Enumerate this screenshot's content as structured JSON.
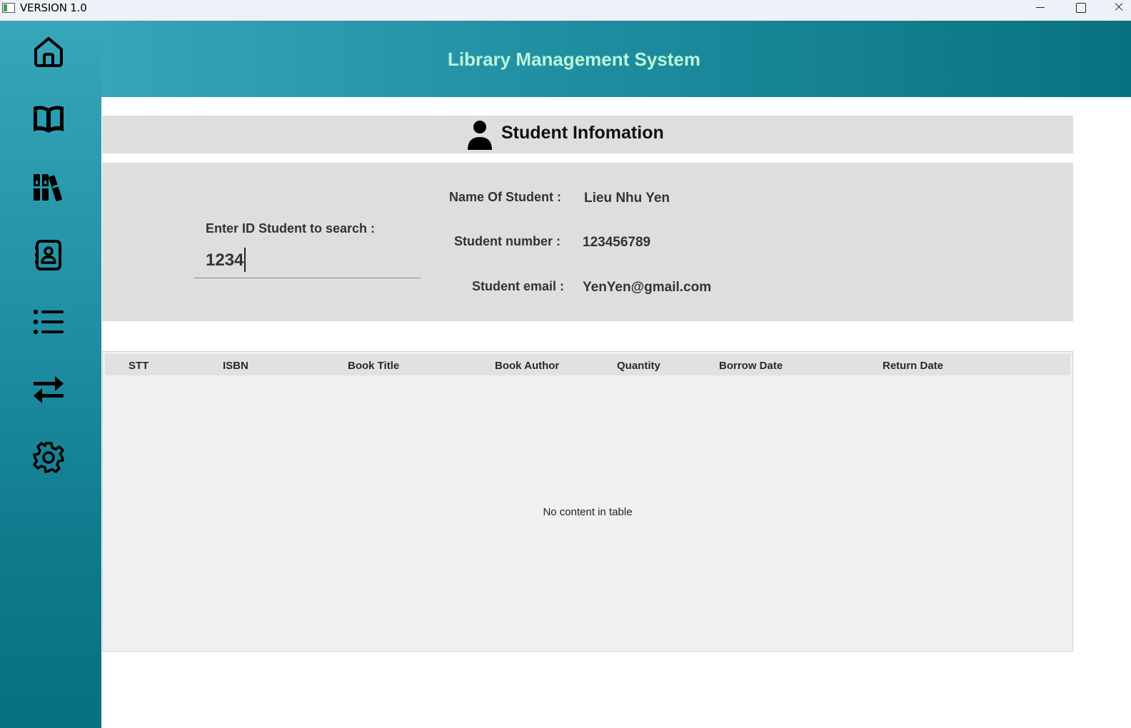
{
  "window": {
    "title": "VERSION 1.0"
  },
  "header": {
    "title": "Library Management System"
  },
  "sidebar": {
    "items": [
      {
        "icon": "home-icon"
      },
      {
        "icon": "book-icon"
      },
      {
        "icon": "library-icon"
      },
      {
        "icon": "contacts-icon"
      },
      {
        "icon": "list-icon"
      },
      {
        "icon": "transfer-icon"
      },
      {
        "icon": "settings-icon"
      }
    ]
  },
  "section": {
    "title": "Student Infomation"
  },
  "search": {
    "label": "Enter ID Student to search :",
    "value": "1234"
  },
  "student": {
    "name_label": "Name Of Student :",
    "name_value": "Lieu Nhu Yen",
    "number_label": "Student number :",
    "number_value": "123456789",
    "email_label": "Student email :",
    "email_value": "YenYen@gmail.com"
  },
  "table": {
    "columns": [
      "STT",
      "ISBN",
      "Book Title",
      "Book Author",
      "Quantity",
      "Borrow Date",
      "Return Date"
    ],
    "rows": [],
    "empty_message": "No content in table"
  },
  "colors": {
    "accent": "#1e8c9f",
    "header_title": "#b9f5da",
    "panel": "#dedede"
  }
}
